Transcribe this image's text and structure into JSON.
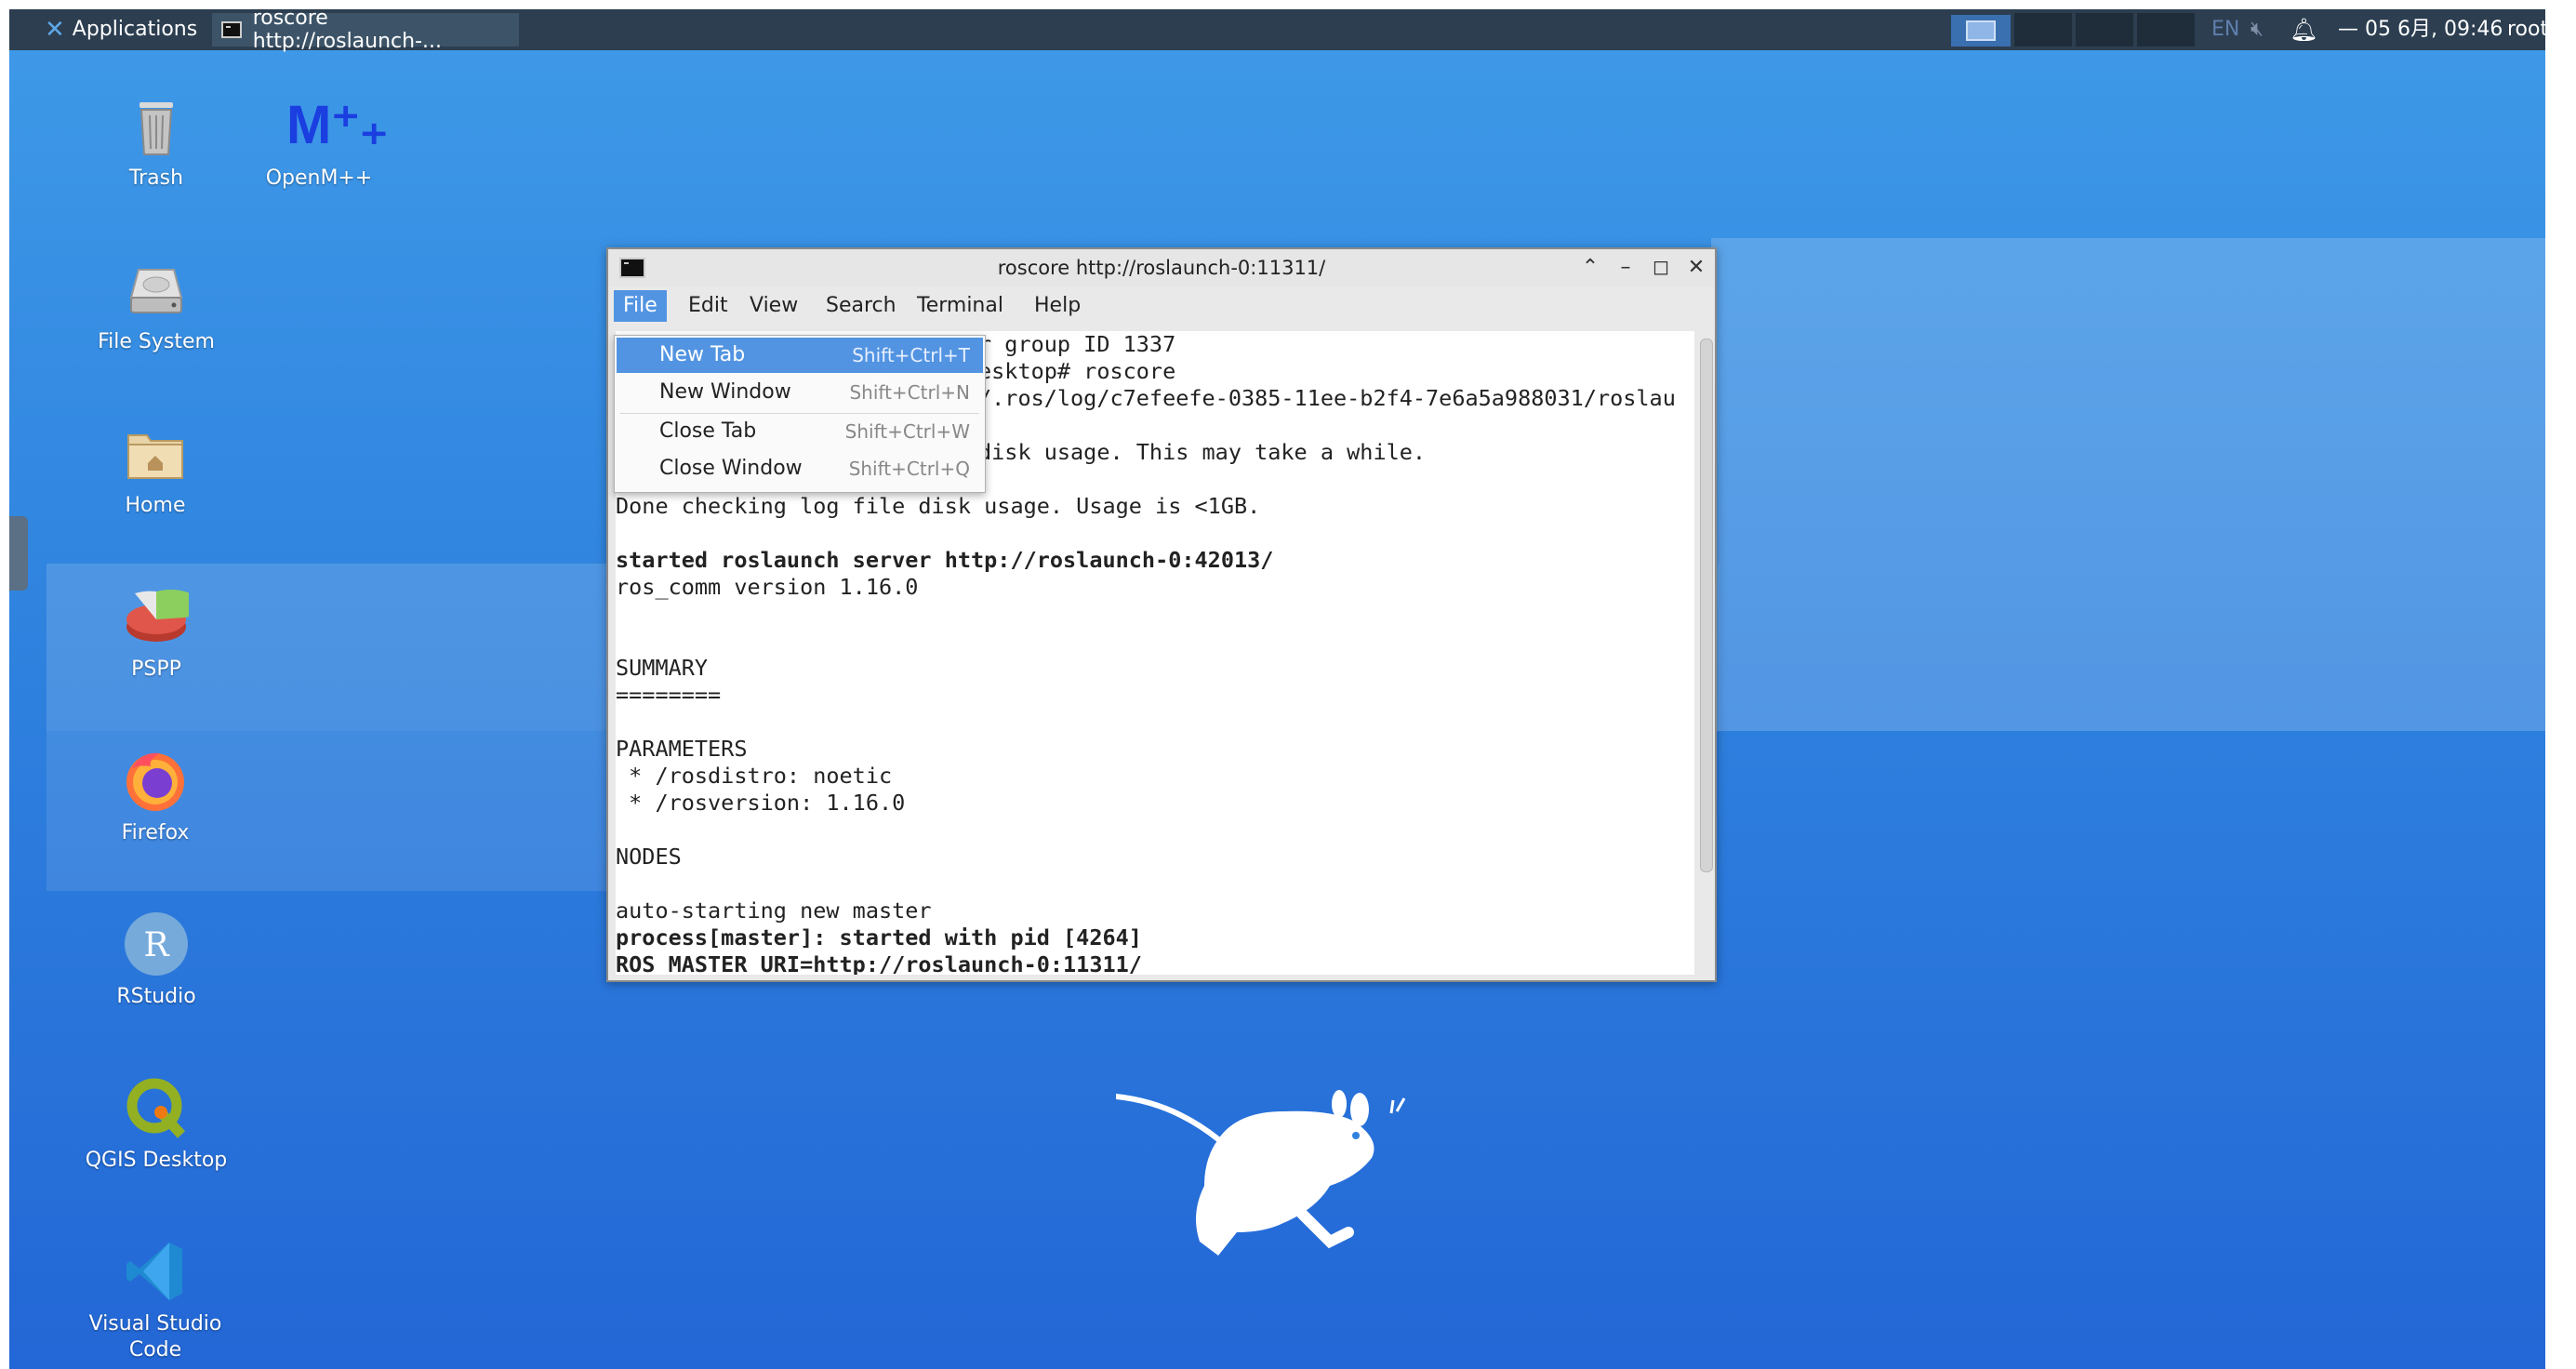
{
  "top_panel": {
    "applications_label": "Applications",
    "taskbar_item_label": "roscore http://roslaunch-...",
    "language": "EN",
    "clock": "— 05 6月, 09:46",
    "user": "root"
  },
  "desktop_icons": [
    {
      "label": "Trash"
    },
    {
      "label": "OpenM++"
    },
    {
      "label": "File System"
    },
    {
      "label": "Home"
    },
    {
      "label": "PSPP"
    },
    {
      "label": "Firefox"
    },
    {
      "label": "RStudio"
    },
    {
      "label": "QGIS Desktop"
    },
    {
      "label": "Visual Studio Code"
    }
  ],
  "openm_logo_text": "M⁺₊",
  "terminal": {
    "title": "roscore http://roslaunch-0:11311/",
    "menu": [
      "File",
      "Edit",
      "View",
      "Search",
      "Terminal",
      "Help"
    ],
    "lines": [
      "r group ID 1337",
      "esktop# roscore",
      "/.ros/log/c7efeefe-0385-11ee-b2f4-7e6a5a988031/roslau",
      "",
      "disk usage. This may take a while.",
      "",
      "Done checking log file disk usage. Usage is <1GB.",
      "",
      "started roslaunch server http://roslaunch-0:42013/",
      "ros_comm version 1.16.0",
      "",
      "",
      "SUMMARY",
      "========",
      "",
      "PARAMETERS",
      " * /rosdistro: noetic",
      " * /rosversion: 1.16.0",
      "",
      "NODES",
      "",
      "auto-starting new master",
      "process[master]: started with pid [4264]",
      "ROS_MASTER_URI=http://roslaunch-0:11311/"
    ]
  },
  "file_menu": [
    {
      "label": "New Tab",
      "shortcut": "Shift+Ctrl+T"
    },
    {
      "label": "New Window",
      "shortcut": "Shift+Ctrl+N"
    },
    {
      "label": "Close Tab",
      "shortcut": "Shift+Ctrl+W"
    },
    {
      "label": "Close Window",
      "shortcut": "Shift+Ctrl+Q"
    }
  ],
  "colors": {
    "accent": "#5294e2",
    "panel": "#2c3e50"
  }
}
